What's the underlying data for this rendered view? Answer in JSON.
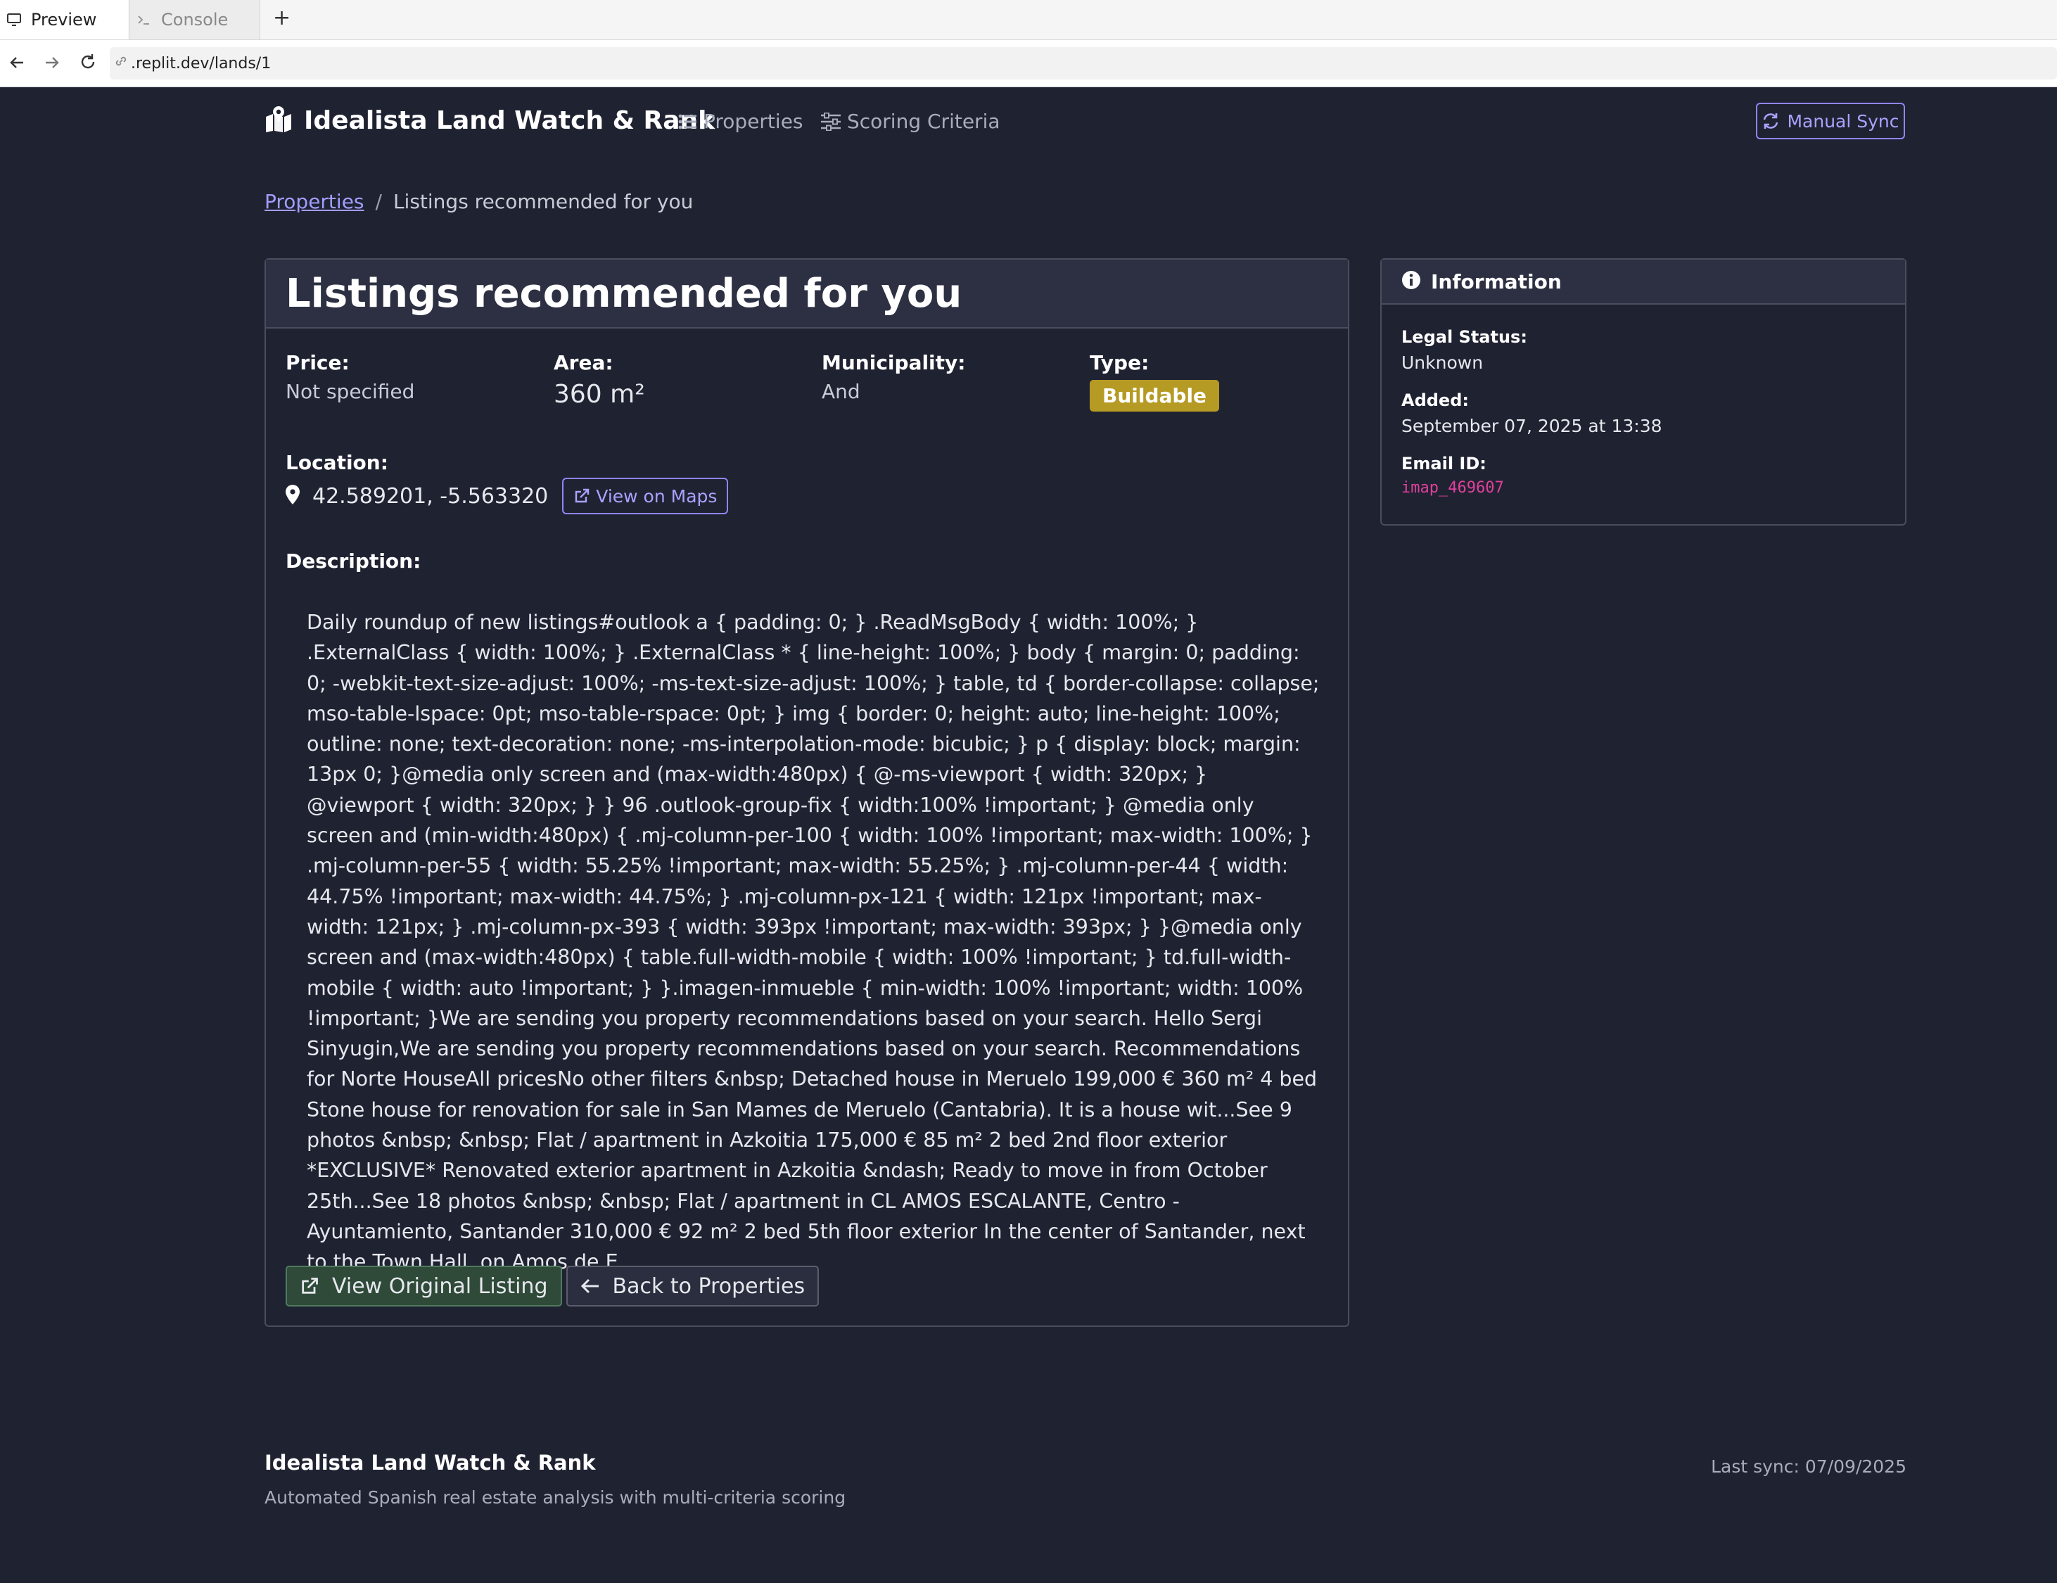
{
  "browser": {
    "tabs": [
      {
        "label": "Preview",
        "icon": "monitor-icon"
      },
      {
        "label": "Console",
        "icon": "terminal-icon"
      }
    ],
    "new_tab": "+",
    "url": ".replit.dev/lands/1"
  },
  "nav": {
    "brand": "Idealista Land Watch & Rank",
    "brand_icon": "map-marked-icon",
    "links": [
      {
        "label": "Properties",
        "icon": "list-icon"
      },
      {
        "label": "Scoring Criteria",
        "icon": "sliders-icon"
      }
    ],
    "sync_button": "Manual Sync"
  },
  "breadcrumb": {
    "parent": "Properties",
    "separator": "/",
    "current": "Listings recommended for you"
  },
  "listing": {
    "title": "Listings recommended for you",
    "price_label": "Price:",
    "price": "Not specified",
    "area_label": "Area:",
    "area": "360 m²",
    "municipality_label": "Municipality:",
    "municipality": "And",
    "type_label": "Type:",
    "type": "Buildable",
    "location_label": "Location:",
    "coordinates": "42.589201, -5.563320",
    "maps_button": "View on Maps",
    "description_label": "Description:",
    "description": "Daily roundup of new listings#outlook a { padding: 0; } .ReadMsgBody { width: 100%; } .ExternalClass { width: 100%; } .ExternalClass * { line-height: 100%; } body { margin: 0; padding: 0; -webkit-text-size-adjust: 100%; -ms-text-size-adjust: 100%; } table, td { border-collapse: collapse; mso-table-lspace: 0pt; mso-table-rspace: 0pt; } img { border: 0; height: auto; line-height: 100%; outline: none; text-decoration: none; -ms-interpolation-mode: bicubic; } p { display: block; margin: 13px 0; }@media only screen and (max-width:480px) { @-ms-viewport { width: 320px; } @viewport { width: 320px; } } 96 .outlook-group-fix { width:100% !important; } @media only screen and (min-width:480px) { .mj-column-per-100 { width: 100% !important; max-width: 100%; } .mj-column-per-55 { width: 55.25% !important; max-width: 55.25%; } .mj-column-per-44 { width: 44.75% !important; max-width: 44.75%; } .mj-column-px-121 { width: 121px !important; max-width: 121px; } .mj-column-px-393 { width: 393px !important; max-width: 393px; } }@media only screen and (max-width:480px) { table.full-width-mobile { width: 100% !important; } td.full-width-mobile { width: auto !important; } }.imagen-inmueble { min-width: 100% !important; width: 100% !important; }We are sending you property recommendations based on your search. Hello Sergi Sinyugin,We are sending you property recommendations based on your search. Recommendations for Norte HouseAll pricesNo other filters &nbsp; Detached house in Meruelo 199,000 € 360 m² 4 bed Stone house for renovation for sale in San Mames de Meruelo (Cantabria). It is a house wit...See 9 photos &nbsp; &nbsp; Flat / apartment in Azkoitia 175,000 € 85 m² 2 bed 2nd floor exterior *EXCLUSIVE* Renovated exterior apartment in Azkoitia &ndash; Ready to move in from October 25th...See 18 photos &nbsp; &nbsp; Flat / apartment in CL AMOS ESCALANTE, Centro - Ayuntamiento, Santander 310,000 € 92 m² 2 bed 5th floor exterior In the center of Santander, next to the Town Hall, on Amos de E...",
    "view_original_button": "View Original Listing",
    "back_button": "Back to Properties"
  },
  "info": {
    "title": "Information",
    "legal_status_label": "Legal Status:",
    "legal_status": "Unknown",
    "added_label": "Added:",
    "added": "September 07, 2025 at 13:38",
    "email_id_label": "Email ID:",
    "email_id": "imap_469607"
  },
  "footer": {
    "title": "Idealista Land Watch & Rank",
    "subtitle": "Automated Spanish real estate analysis with multi-criteria scoring",
    "last_sync": "Last sync: 07/09/2025"
  },
  "colors": {
    "background": "#1f2231",
    "accent": "#8f86ff",
    "badge": "#b59a23",
    "green_button": "#2f4a39",
    "code": "#e0409c"
  }
}
